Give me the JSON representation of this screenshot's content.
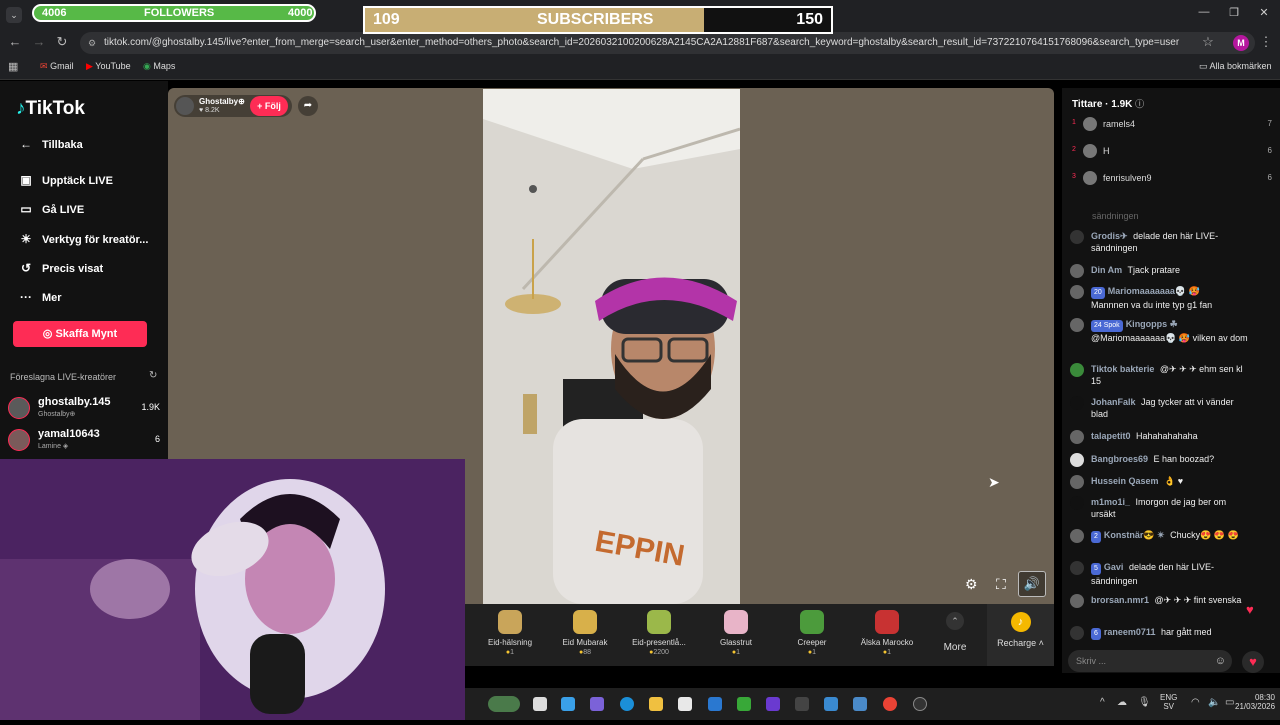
{
  "browser": {
    "url": "tiktok.com/@ghostalby.145/live?enter_from_merge=search_user&enter_method=others_photo&search_id=2026032100200628A2145CA2A12881F687&search_keyword=ghostalby&search_result_id=7372210764151768096&search_type=user",
    "bookmarks": [
      "Gmail",
      "YouTube",
      "Maps"
    ],
    "all_bookmarks": "Alla bokmärken",
    "profile_initial": "M"
  },
  "overlay": {
    "followers": {
      "current": "4006",
      "label": "FOLLOWERS",
      "goal": "4000",
      "progress": 1.0
    },
    "subscribers": {
      "current": "109",
      "label": "SUBSCRIBERS",
      "goal": "150",
      "progress": 0.7267
    }
  },
  "sidebar": {
    "logo": "TikTok",
    "back": "Tillbaka",
    "items": [
      {
        "label": "Upptäck LIVE",
        "icon": "calendar-live-icon"
      },
      {
        "label": "Gå LIVE",
        "icon": "camera-icon"
      },
      {
        "label": "Verktyg för kreatör...",
        "icon": "lightbulb-icon"
      },
      {
        "label": "Precis visat",
        "icon": "history-icon"
      },
      {
        "label": "Mer",
        "icon": "more-icon"
      }
    ],
    "coins_button": "Skaffa Mynt",
    "suggested_title": "Föreslagna LIVE-kreatörer",
    "suggested": [
      {
        "name": "ghostalby.145",
        "sub": "Ghostalby⊕",
        "count": "1.9K"
      },
      {
        "name": "yamal10643",
        "sub": "Lamine ◈",
        "count": "6"
      }
    ]
  },
  "stream": {
    "host_name": "Ghostalby⊕",
    "host_likes": "♥ 8.2K",
    "follow_button": "+ Följ"
  },
  "gifts": [
    {
      "name": "Eid-hälsning",
      "price": "1",
      "color": "#c9a55a"
    },
    {
      "name": "Eid Mubarak",
      "price": "88",
      "color": "#d8b04a"
    },
    {
      "name": "Eid-presentlå...",
      "price": "2200",
      "color": "#9bb84a"
    },
    {
      "name": "Glasstrut",
      "price": "1",
      "color": "#e8b4c8"
    },
    {
      "name": "Creeper",
      "price": "1",
      "color": "#4c9b3c"
    },
    {
      "name": "Älska Marocko",
      "price": "1",
      "color": "#c83232"
    }
  ],
  "gift_more": "More",
  "recharge": "Recharge ˄",
  "right_panel": {
    "viewers_title": "Tittare · 1.9K",
    "top_viewers": [
      {
        "rank": "1",
        "name": "ramels4",
        "count": "7"
      },
      {
        "rank": "2",
        "name": "H",
        "count": "6"
      },
      {
        "rank": "3",
        "name": "fenrisulven9",
        "count": "6"
      }
    ],
    "chat_faded": "sändningen",
    "chat": [
      {
        "user": "Grodis✈",
        "badge": "",
        "text": "delade den här LIVE-sändningen"
      },
      {
        "user": "Din Am",
        "badge": "",
        "text": "Tjack pratare"
      },
      {
        "user": "Mariomaaaaaaa💀 🥵",
        "badge": "20",
        "text": "Mannnen va du inte typ g1 fan"
      },
      {
        "user": "Kingopps ☘",
        "badge": "24  Spok",
        "text": "@Mariomaaaaaaa💀 🥵 vilken av dom"
      },
      {
        "user": "Tiktok bakterie",
        "badge": "",
        "text": "@✈ ✈ ✈ ehm sen kl 15"
      },
      {
        "user": "JohanFalk",
        "badge": "",
        "text": "Jag tycker att vi vänder blad"
      },
      {
        "user": "talapetit0",
        "badge": "",
        "text": "Hahahahahaha"
      },
      {
        "user": "Bangbroes69",
        "badge": "",
        "text": "E han boozad?"
      },
      {
        "user": "Hussein Qasem",
        "badge": "",
        "text": "👌 ♥"
      },
      {
        "user": "m1mo1i_",
        "badge": "",
        "text": "Imorgon de jag ber om ursäkt"
      },
      {
        "user": "Konstnär😎 ✴",
        "badge": "2",
        "text": "Chucky😍 😍 😍"
      },
      {
        "user": "Gavi",
        "badge": "5",
        "text": "delade den här LIVE-sändningen"
      },
      {
        "user": "brorsan.nmr1",
        "badge": "",
        "text": "@✈ ✈ ✈ fint svenska"
      },
      {
        "user": "raneem0711",
        "badge": "6",
        "text": "har gått med"
      }
    ],
    "input_placeholder": "Skriv ..."
  },
  "taskbar": {
    "lang": "ENG",
    "region": "SV",
    "time": "08:30",
    "date": "21/03/2026"
  }
}
